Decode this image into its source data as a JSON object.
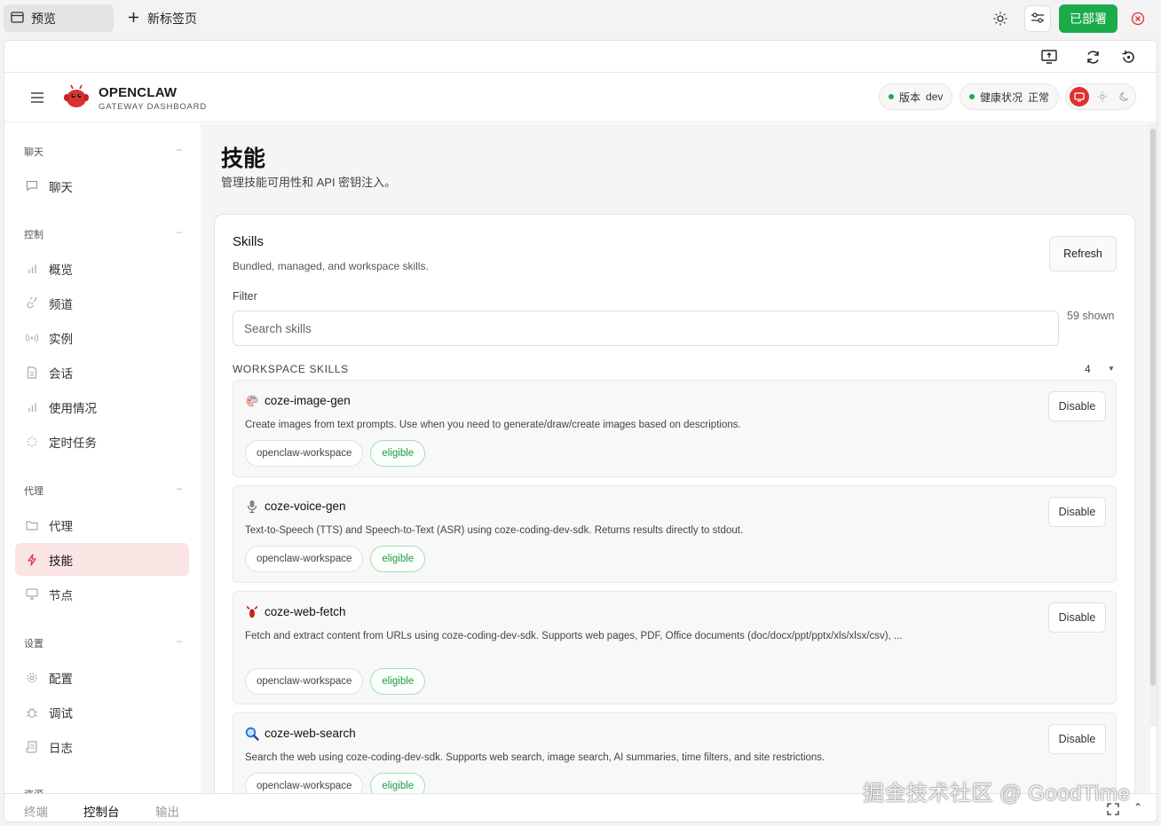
{
  "browser": {
    "active_tab": "预览",
    "new_tab": "新标签页",
    "deploy_label": "已部署"
  },
  "app": {
    "brand_title": "OPENCLAW",
    "brand_subtitle": "GATEWAY DASHBOARD",
    "version_label": "版本",
    "version_value": "dev",
    "health_label": "健康状况",
    "health_value": "正常"
  },
  "sidebar": {
    "sections": [
      {
        "title": "聊天",
        "items": [
          {
            "label": "聊天",
            "icon": "chat-icon"
          }
        ]
      },
      {
        "title": "控制",
        "items": [
          {
            "label": "概览",
            "icon": "bar-chart-icon"
          },
          {
            "label": "频道",
            "icon": "link-icon"
          },
          {
            "label": "实例",
            "icon": "broadcast-icon"
          },
          {
            "label": "会话",
            "icon": "document-icon"
          },
          {
            "label": "使用情况",
            "icon": "bar-chart-icon"
          },
          {
            "label": "定时任务",
            "icon": "loader-icon"
          }
        ]
      },
      {
        "title": "代理",
        "items": [
          {
            "label": "代理",
            "icon": "folder-icon"
          },
          {
            "label": "技能",
            "icon": "lightning-icon",
            "active": true
          },
          {
            "label": "节点",
            "icon": "monitor-icon"
          }
        ]
      },
      {
        "title": "设置",
        "items": [
          {
            "label": "配置",
            "icon": "gear-icon"
          },
          {
            "label": "调试",
            "icon": "bug-icon"
          },
          {
            "label": "日志",
            "icon": "scroll-icon"
          }
        ]
      }
    ],
    "clipped_section": "资源"
  },
  "page": {
    "title": "技能",
    "subtitle": "管理技能可用性和 API 密钥注入。"
  },
  "skills_card": {
    "title": "Skills",
    "subtitle": "Bundled, managed, and workspace skills.",
    "refresh_label": "Refresh",
    "filter_label": "Filter",
    "search_placeholder": "Search skills",
    "shown_count": "59 shown",
    "group_title": "WORKSPACE SKILLS",
    "group_count": "4",
    "skills": [
      {
        "icon": "palette-icon",
        "name": "coze-image-gen",
        "description": "Create images from text prompts. Use when you need to generate/draw/create images based on descriptions.",
        "source": "openclaw-workspace",
        "status": "eligible",
        "action": "Disable"
      },
      {
        "icon": "microphone-icon",
        "name": "coze-voice-gen",
        "description": "Text-to-Speech (TTS) and Speech-to-Text (ASR) using coze-coding-dev-sdk. Returns results directly to stdout.",
        "source": "openclaw-workspace",
        "status": "eligible",
        "action": "Disable"
      },
      {
        "icon": "lobster-icon",
        "name": "coze-web-fetch",
        "description": "Fetch and extract content from URLs using coze-coding-dev-sdk. Supports web pages, PDF, Office documents (doc/docx/ppt/pptx/xls/xlsx/csv), ...",
        "source": "openclaw-workspace",
        "status": "eligible",
        "action": "Disable"
      },
      {
        "icon": "magnifier-icon",
        "name": "coze-web-search",
        "description": "Search the web using coze-coding-dev-sdk. Supports web search, image search, AI summaries, time filters, and site restrictions.",
        "source": "openclaw-workspace",
        "status": "eligible",
        "action": "Disable"
      }
    ]
  },
  "bottom_tabs": [
    "终端",
    "控制台",
    "输出"
  ],
  "bottom_active": "控制台",
  "watermark": "掘金技术社区 @ GoodTime",
  "colors": {
    "accent_red": "#e03030",
    "deploy_green": "#1bab4a",
    "eligible_green": "#1b9a44",
    "active_nav_bg": "#fbe4e4"
  }
}
